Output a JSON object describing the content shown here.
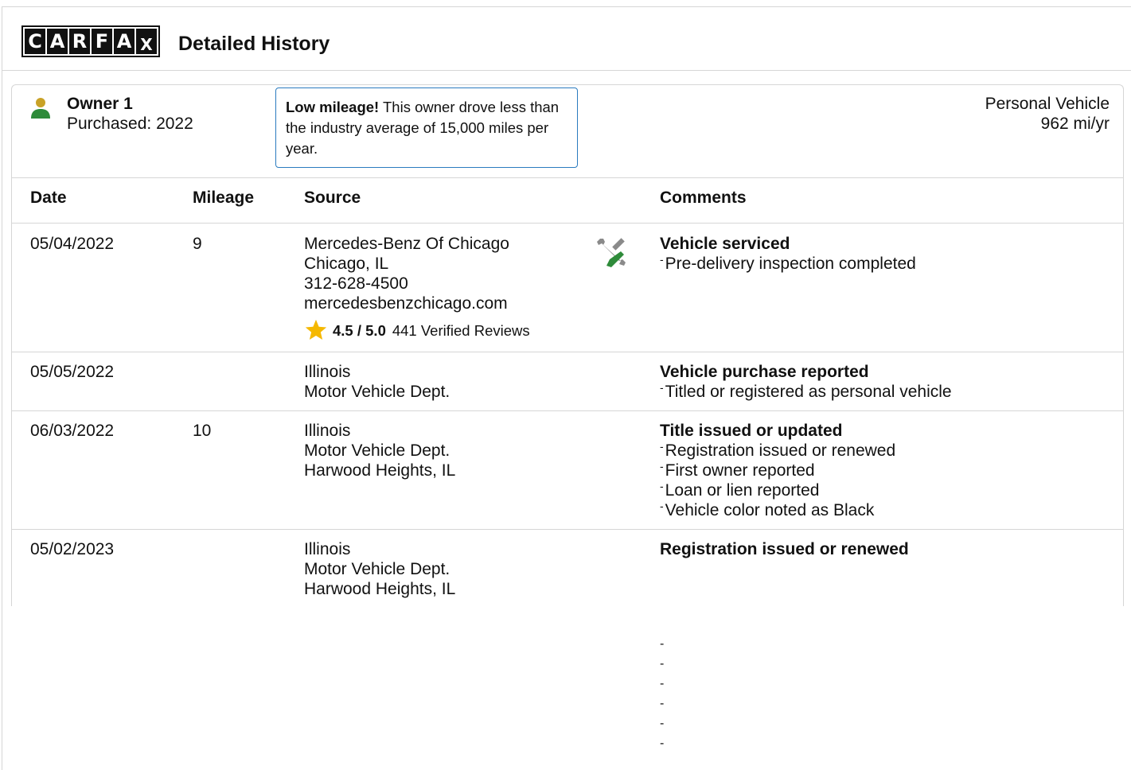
{
  "header": {
    "logo_letters": [
      "C",
      "A",
      "R",
      "F",
      "A",
      "X"
    ],
    "title": "Detailed History"
  },
  "owner": {
    "name": "Owner 1",
    "purchased": "Purchased: 2022",
    "callout_bold": "Low mileage!",
    "callout_text": " This owner drove less than the industry average of 15,000 miles per year.",
    "vehicle_type": "Personal Vehicle",
    "miles_per_year": "962 mi/yr",
    "icon": "person-icon"
  },
  "table": {
    "headers": {
      "date": "Date",
      "mileage": "Mileage",
      "source": "Source",
      "comments": "Comments"
    },
    "rows": [
      {
        "date": "05/04/2022",
        "mileage": "9",
        "source": [
          "Mercedes-Benz Of Chicago",
          "Chicago, IL",
          "312-628-4500",
          "mercedesbenzchicago.com"
        ],
        "rating": {
          "score": "4.5 / 5.0",
          "reviews": "441 Verified Reviews",
          "icon": "star-icon"
        },
        "service_icon": "wrench-screwdriver-icon",
        "comment_title": "Vehicle serviced",
        "comments": [
          "Pre-delivery inspection completed"
        ]
      },
      {
        "date": "05/05/2022",
        "mileage": "",
        "source": [
          "Illinois",
          "Motor Vehicle Dept."
        ],
        "comment_title": "Vehicle purchase reported",
        "comments": [
          "Titled or registered as personal vehicle"
        ]
      },
      {
        "date": "06/03/2022",
        "mileage": "10",
        "source": [
          "Illinois",
          "Motor Vehicle Dept.",
          "Harwood Heights, IL"
        ],
        "comment_title": "Title issued or updated",
        "comments": [
          "Registration issued or renewed",
          "First owner reported",
          "Loan or lien reported",
          "Vehicle color noted as Black"
        ]
      },
      {
        "date": "05/02/2023",
        "mileage": "",
        "source": [
          "Illinois",
          "Motor Vehicle Dept.",
          "Harwood Heights, IL"
        ],
        "comment_title": "Registration issued or renewed",
        "comments": []
      }
    ]
  },
  "ghost_dashes": [
    "-",
    "-",
    "-",
    "-",
    "-",
    "-"
  ],
  "colors": {
    "callout_border": "#2a7bbf",
    "star": "#f5b800",
    "person_head": "#c9a227",
    "person_body": "#2e8b3a",
    "tool_green": "#2e8b3a",
    "tool_gray": "#8a8a8a"
  }
}
